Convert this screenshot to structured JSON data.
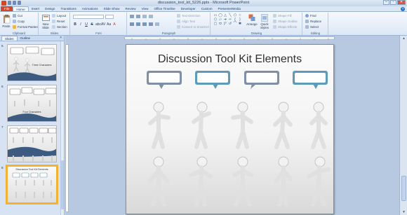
{
  "window": {
    "title": "discussion_tool_kit_5226.pptx - Microsoft PowerPoint",
    "controls": [
      "–",
      "▫",
      "✕"
    ]
  },
  "ribbon_tabs": [
    "File",
    "Home",
    "Insert",
    "Design",
    "Transitions",
    "Animations",
    "Slide Show",
    "Review",
    "View",
    "Office Timeline",
    "Developer",
    "Custom",
    "PresenterMedia"
  ],
  "active_tab": "Home",
  "help_label": "?",
  "clipboard": {
    "paste": "Paste",
    "cut": "Cut",
    "copy": "Copy",
    "format_painter": "Format Painter",
    "label": "Clipboard"
  },
  "slides_group": {
    "new_slide": "New Slide",
    "layout": "Layout",
    "reset": "Reset",
    "section": "Section",
    "label": "Slides"
  },
  "font_group": {
    "font_size": "",
    "buttons": [
      "B",
      "I",
      "U",
      "S",
      "abc",
      "AV",
      "Aa",
      "A"
    ],
    "label": "Font"
  },
  "paragraph_group": {
    "text_direction": "Text Direction",
    "align_text": "Align Text",
    "convert_smartart": "Convert to SmartArt",
    "label": "Paragraph"
  },
  "drawing_group": {
    "arrange": "Arrange",
    "quick_styles": "Quick Styles",
    "shape_fill": "Shape Fill",
    "shape_outline": "Shape Outline",
    "shape_effects": "Shape Effects",
    "label": "Drawing",
    "shape_glyphs": [
      "▭",
      "◯",
      "△",
      "╲",
      "⬠",
      "☆",
      "⬡",
      "▱",
      "➔",
      "⇨",
      "{",
      "}",
      "▢",
      "⬭",
      "◸",
      "↺",
      "⌒",
      "✱"
    ]
  },
  "editing_group": {
    "find": "Find",
    "replace": "Replace",
    "select": "Select",
    "label": "Editing"
  },
  "left_panel": {
    "tabs": [
      "Slides",
      "Outline"
    ],
    "close": "×",
    "thumbnails": [
      {
        "number": "5",
        "title": "Three Characters"
      },
      {
        "number": "6",
        "title": "Four Characters"
      },
      {
        "number": "7",
        "title": ""
      },
      {
        "number": "8",
        "title": "Discussion Tool Kit Elements",
        "selected": true
      }
    ]
  },
  "slide": {
    "title": "Discussion Tool Kit Elements"
  },
  "scroll": {
    "up": "▲",
    "down": "▼"
  },
  "colors": {
    "file_tab": "#d24726",
    "selection": "#f2b233",
    "bubble_blue": "#5e9bb8",
    "bubble_gray": "#7f8fa6"
  }
}
